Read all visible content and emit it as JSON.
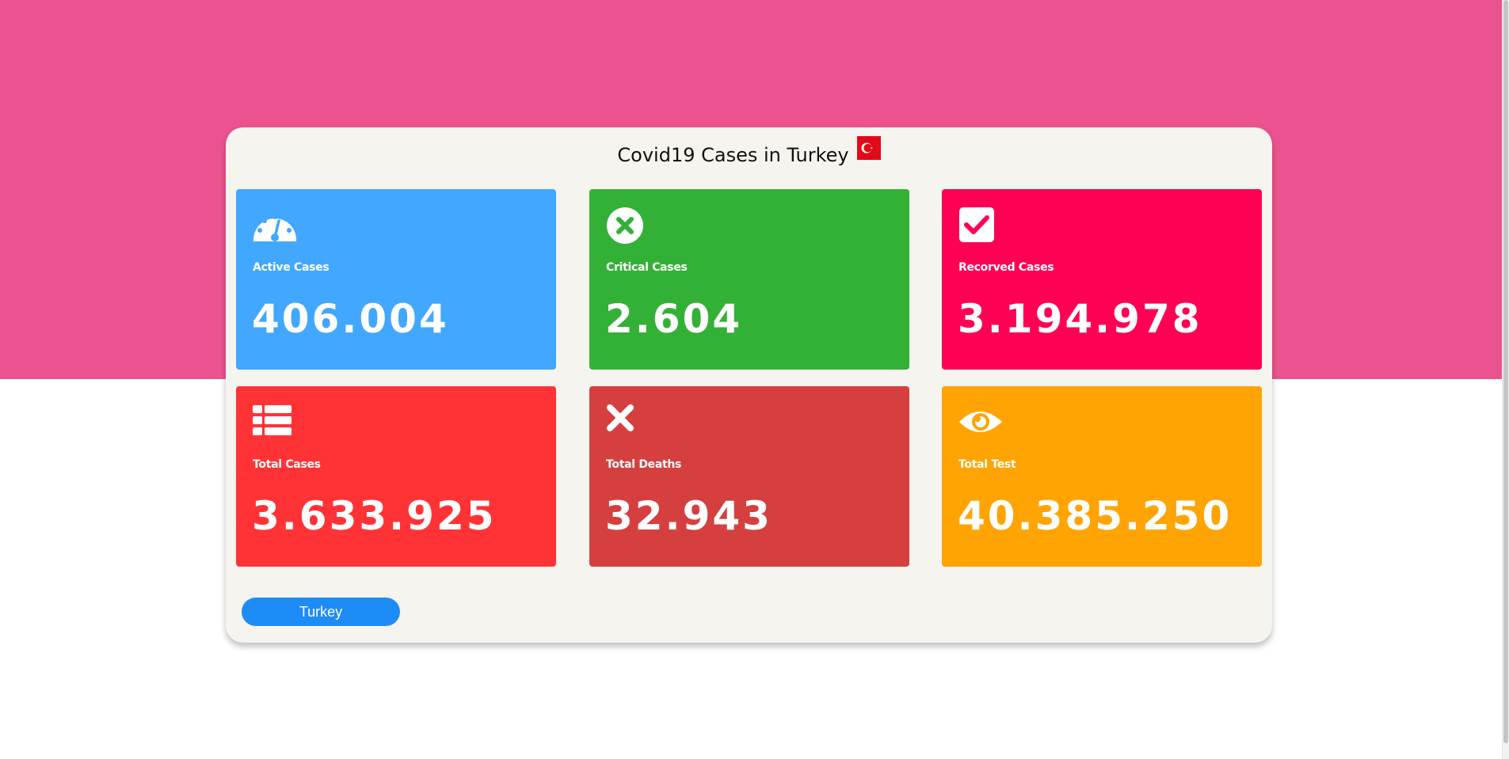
{
  "page": {
    "title": "Covid19 Cases in Turkey",
    "flag_icon": "turkey-flag-icon",
    "background_top_color": "#ea538f"
  },
  "stats": [
    {
      "key": "active",
      "label": "Active Cases",
      "value": "406.004",
      "color": "#42a7fe",
      "icon": "speedometer-icon"
    },
    {
      "key": "critical",
      "label": "Critical Cases",
      "value": "2.604",
      "color": "#33b137",
      "icon": "x-circle-icon"
    },
    {
      "key": "recovered",
      "label": "Recorved Cases",
      "value": "3.194.978",
      "color": "#ff0154",
      "icon": "check-square-icon"
    },
    {
      "key": "total",
      "label": "Total Cases",
      "value": "3.633.925",
      "color": "#ff3336",
      "icon": "table-list-icon"
    },
    {
      "key": "deaths",
      "label": "Total Deaths",
      "value": "32.943",
      "color": "#d63f3f",
      "icon": "x-mark-icon"
    },
    {
      "key": "tests",
      "label": "Total Test",
      "value": "40.385.250",
      "color": "#ffa402",
      "icon": "eye-icon"
    }
  ],
  "country_button": {
    "label": "Turkey",
    "color": "#1e8cf6"
  }
}
